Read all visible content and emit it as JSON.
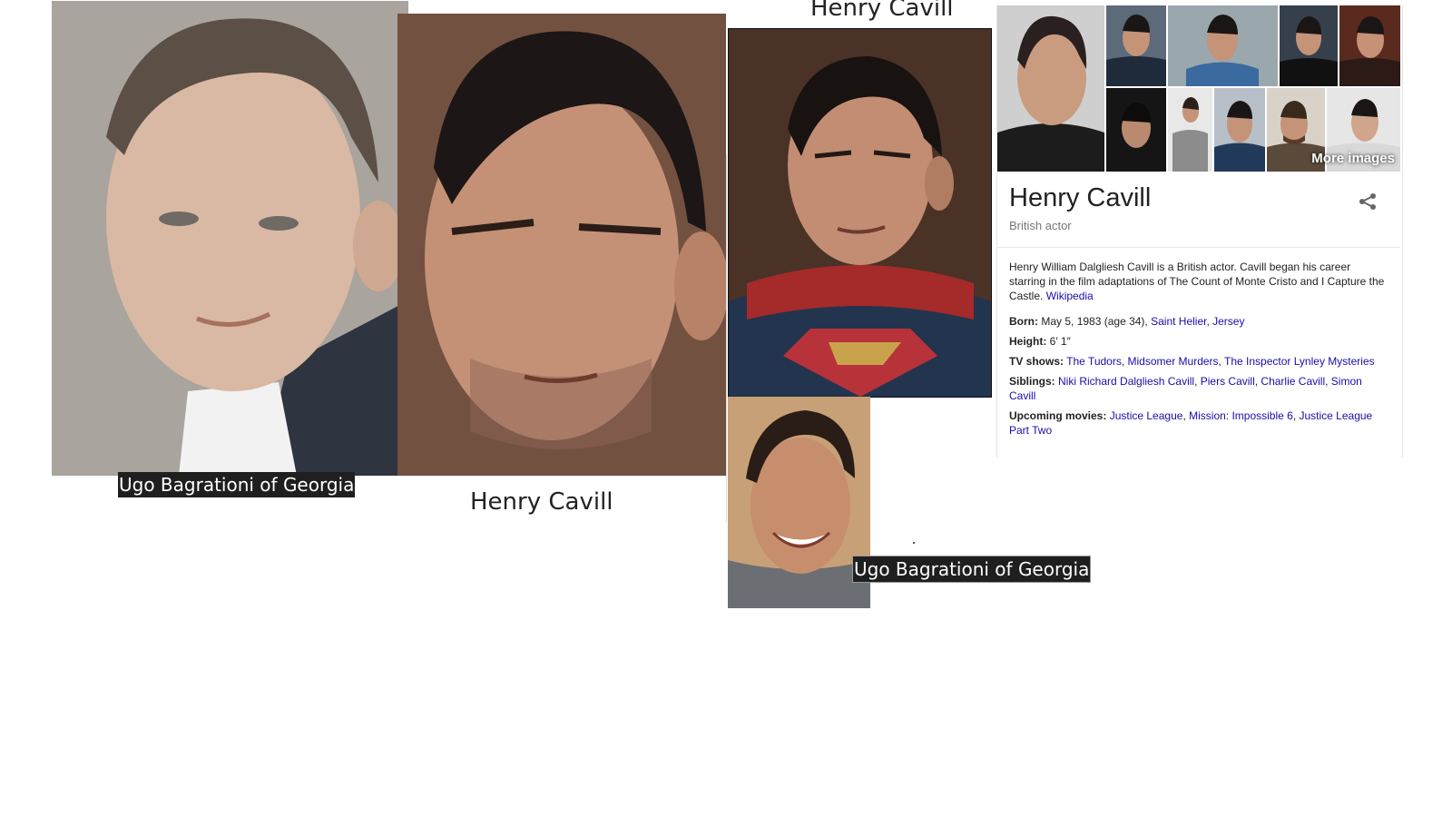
{
  "captions": {
    "left_caption": "Ugo Bagrationi of Georgia",
    "middle_caption": "Henry Cavill",
    "top_caption": "Henry Cavill",
    "bottom_caption": "Ugo Bagrationi of Georgia"
  },
  "knowledge_panel": {
    "more_images": "More images",
    "title": "Henry Cavill",
    "subtitle": "British actor",
    "share_icon": "share-icon",
    "description": "Henry William Dalgliesh Cavill is a British actor. Cavill began his career starring in the film adaptations of The Count of Monte Cristo and I Capture the Castle.",
    "description_link": "Wikipedia",
    "facts": {
      "born_label": "Born:",
      "born_text": "May 5, 1983 (age 34),",
      "born_link": "Saint Helier, Jersey",
      "height_label": "Height:",
      "height_value": "6′ 1″",
      "tv_label": "TV shows:",
      "tv_1": "The Tudors",
      "tv_2": "Midsomer Murders",
      "tv_3": "The Inspector Lynley Mysteries",
      "siblings_label": "Siblings:",
      "sib_1": "Niki Richard Dalgliesh Cavill",
      "sib_2": "Piers Cavill",
      "sib_3": "Charlie Cavill",
      "sib_4": "Simon Cavill",
      "movies_label": "Upcoming movies:",
      "mov_1": "Justice League",
      "mov_2": "Mission: Impossible 6",
      "mov_3": "Justice League Part Two"
    }
  },
  "colors": {
    "link": "#1a0dab",
    "caption_bg": "#1f1f1f"
  }
}
